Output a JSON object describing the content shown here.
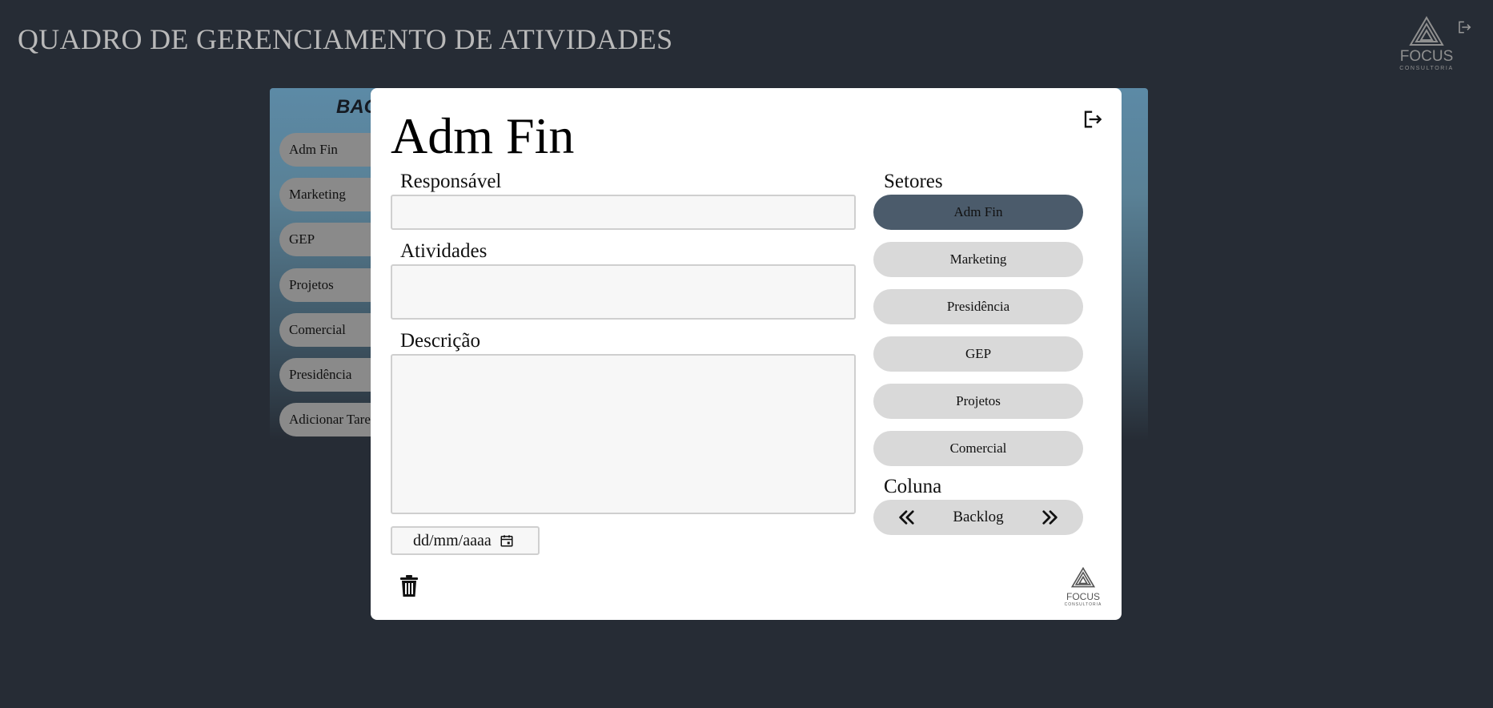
{
  "header": {
    "title": "QUADRO DE GERENCIAMENTO DE ATIVIDADES",
    "logo_brand": "FOCUS",
    "logo_sub": "CONSULTORIA"
  },
  "board": {
    "column_title": "BAC",
    "items": [
      "Adm Fin",
      "Marketing",
      "GEP",
      "Projetos",
      "Comercial",
      "Presidência",
      "Adicionar Tarefa"
    ]
  },
  "modal": {
    "title": "Adm Fin",
    "responsavel_label": "Responsável",
    "responsavel_value": "",
    "atividades_label": "Atividades",
    "atividades_value": "",
    "descricao_label": "Descrição",
    "descricao_value": "",
    "date_placeholder": "dd/mm/aaaa",
    "setores_label": "Setores",
    "setores": [
      {
        "label": "Adm Fin",
        "active": true
      },
      {
        "label": "Marketing",
        "active": false
      },
      {
        "label": "Presidência",
        "active": false
      },
      {
        "label": "GEP",
        "active": false
      },
      {
        "label": "Projetos",
        "active": false
      },
      {
        "label": "Comercial",
        "active": false
      }
    ],
    "coluna_label": "Coluna",
    "coluna_value": "Backlog",
    "logo_brand": "FOCUS",
    "logo_sub": "CONSULTORIA"
  },
  "colors": {
    "background": "#262c35",
    "active_sector": "#4b5b6b",
    "sector": "#d9d9d9"
  }
}
